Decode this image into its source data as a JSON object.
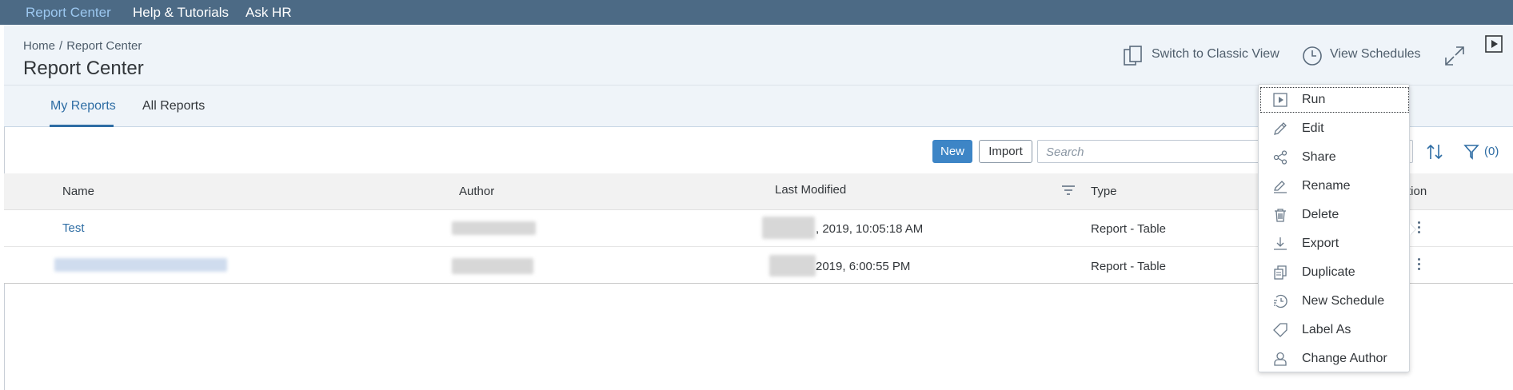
{
  "topnav": {
    "items": [
      "Report Center",
      "Help & Tutorials",
      "Ask HR"
    ],
    "active": "Report Center"
  },
  "breadcrumb": {
    "home": "Home",
    "sep": "/",
    "current": "Report Center"
  },
  "page": {
    "title": "Report Center"
  },
  "header_actions": {
    "classic_view": "Switch to Classic View",
    "schedules": "View Schedules"
  },
  "tabs": {
    "my_reports": "My Reports",
    "all_reports": "All Reports",
    "active": "My Reports"
  },
  "toolbar": {
    "new_label": "New",
    "import_label": "Import",
    "search_placeholder": "Search",
    "filter_count": "(0)"
  },
  "table": {
    "columns": {
      "name": "Name",
      "author": "Author",
      "modified": "Last Modified",
      "type": "Type",
      "action_partial": "tion"
    },
    "rows": [
      {
        "name": "Test",
        "modified": ", 2019, 10:05:18 AM",
        "type": "Report - Table"
      },
      {
        "name": "",
        "modified": "2019, 6:00:55 PM",
        "type": "Report - Table"
      }
    ]
  },
  "context_menu": {
    "items": [
      {
        "label": "Run",
        "icon": "run-icon"
      },
      {
        "label": "Edit",
        "icon": "pencil-icon"
      },
      {
        "label": "Share",
        "icon": "share-icon"
      },
      {
        "label": "Rename",
        "icon": "rename-icon"
      },
      {
        "label": "Delete",
        "icon": "trash-icon"
      },
      {
        "label": "Export",
        "icon": "download-icon"
      },
      {
        "label": "Duplicate",
        "icon": "duplicate-icon"
      },
      {
        "label": "New Schedule",
        "icon": "schedule-icon"
      },
      {
        "label": "Label As",
        "icon": "tag-icon"
      },
      {
        "label": "Change Author",
        "icon": "person-icon"
      }
    ]
  },
  "colors": {
    "topbar": "#4c6a85",
    "accent": "#2e6da4",
    "header_bg": "#eff4f9",
    "primary_button": "#3d85c6"
  }
}
